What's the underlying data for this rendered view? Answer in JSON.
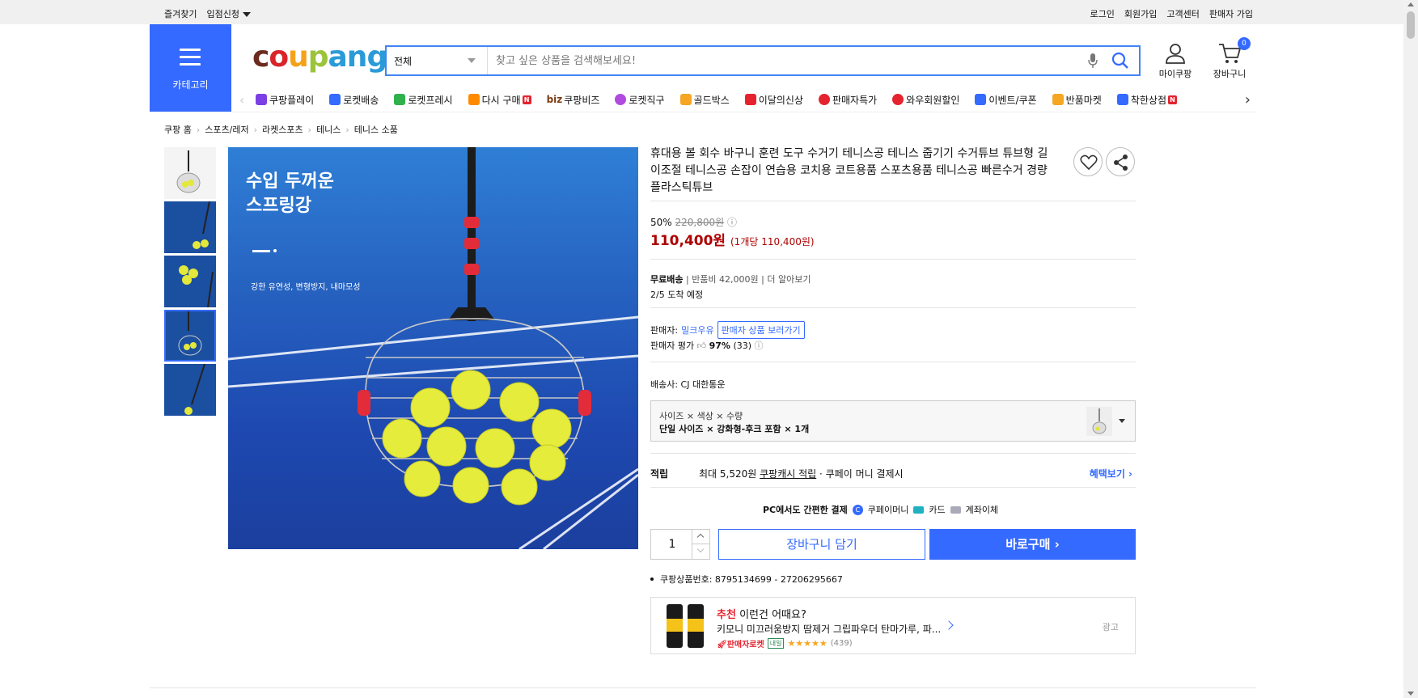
{
  "topbar": {
    "bookmark": "즐겨찾기",
    "seller_apply": "입점신청",
    "login": "로그인",
    "signup": "회원가입",
    "cs": "고객센터",
    "seller_signup": "판매자 가입"
  },
  "category_button": {
    "label": "카테고리"
  },
  "logo": {
    "c": "c",
    "o": "o",
    "u": "u",
    "p": "p",
    "a": "a",
    "n": "n",
    "g": "g"
  },
  "search": {
    "category": "전체",
    "placeholder": "찾고 싶은 상품을 검색해보세요!"
  },
  "header": {
    "my_coupang": "마이쿠팡",
    "cart": "장바구니",
    "cart_count": "0"
  },
  "nav": {
    "items": [
      {
        "label": "쿠팡플레이",
        "color": "#7b3fe4"
      },
      {
        "label": "로켓배송",
        "color": "#346aff"
      },
      {
        "label": "로켓프레시",
        "color": "#2fb24c"
      },
      {
        "label": "다시 구매",
        "color": "#ff8a00",
        "badge": "N"
      },
      {
        "label": "쿠팡비즈",
        "prefix": "biz",
        "color": "#7a3b12"
      },
      {
        "label": "로켓직구",
        "color": "#b04be0"
      },
      {
        "label": "골드박스",
        "color": "#f5a623"
      },
      {
        "label": "이달의신상",
        "color": "#e5232f"
      },
      {
        "label": "판매자특가",
        "color": "#e5232f"
      },
      {
        "label": "와우회원할인",
        "color": "#e5232f"
      },
      {
        "label": "이벤트/쿠폰",
        "color": "#346aff"
      },
      {
        "label": "반품마켓",
        "color": "#f5a623"
      },
      {
        "label": "착한상점",
        "color": "#346aff",
        "badge": "N"
      }
    ]
  },
  "breadcrumb": [
    "쿠팡 홈",
    "스포츠/레저",
    "라켓스포츠",
    "테니스",
    "테니스 소품"
  ],
  "main_image": {
    "headline1": "수입 두꺼운",
    "headline2": "스프링강",
    "sub": "강한 유연성, 변형방지, 내마모성"
  },
  "product": {
    "title": "휴대용 볼 회수 바구니 훈련 도구 수거기 테니스공 테니스 줍기기 수거튜브 튜브형 길이조절 테니스공 손잡이 연습용 코치용 코트용품 스포츠용품 테니스공 빠른수거 경량 플라스틱튜브",
    "discount": "50%",
    "original_price": "220,800원",
    "price": "110,400원",
    "unit_price": "(1개당 110,400원)",
    "free_shipping": "무료배송",
    "return_fee": "반품비 42,000원",
    "learn_more": "더 알아보기",
    "arrival": "2/5 도착 예정",
    "seller_label": "판매자:",
    "seller_name": "밀크우유",
    "seller_goto": "판매자 상품 보러가기",
    "seller_rating_label": "판매자 평가",
    "seller_rating": "97%",
    "seller_rating_count": "(33)",
    "carrier": "배송사:  CJ 대한통운",
    "option_label": "사이즈 × 색상 × 수량",
    "option_value": "단일 사이즈 × 강화형-후크 포함 × 1개",
    "reward_title": "적립",
    "reward_text": "최대 5,520원",
    "reward_link": "쿠팡캐시 적립",
    "reward_tail": "· 쿠페이 머니 결제시",
    "reward_more": "혜택보기",
    "pc_pay": "PC에서도 간편한 결제",
    "pay_coupay": "쿠페이머니",
    "pay_card": "카드",
    "pay_bank": "계좌이체",
    "qty": "1",
    "add_cart": "장바구니 담기",
    "buy_now": "바로구매",
    "product_number": "쿠팡상품번호: 8795134699 - 27206295667"
  },
  "ad": {
    "reco": "추천",
    "heading": "이런건 어때요?",
    "name": "키모니 미끄러움방지 땀제거 그립파우더 탄마가루, 파...",
    "rocket": "판매자로켓",
    "tomorrow": "내일",
    "stars": "★★★★★",
    "count": "(439)",
    "tag": "광고"
  }
}
